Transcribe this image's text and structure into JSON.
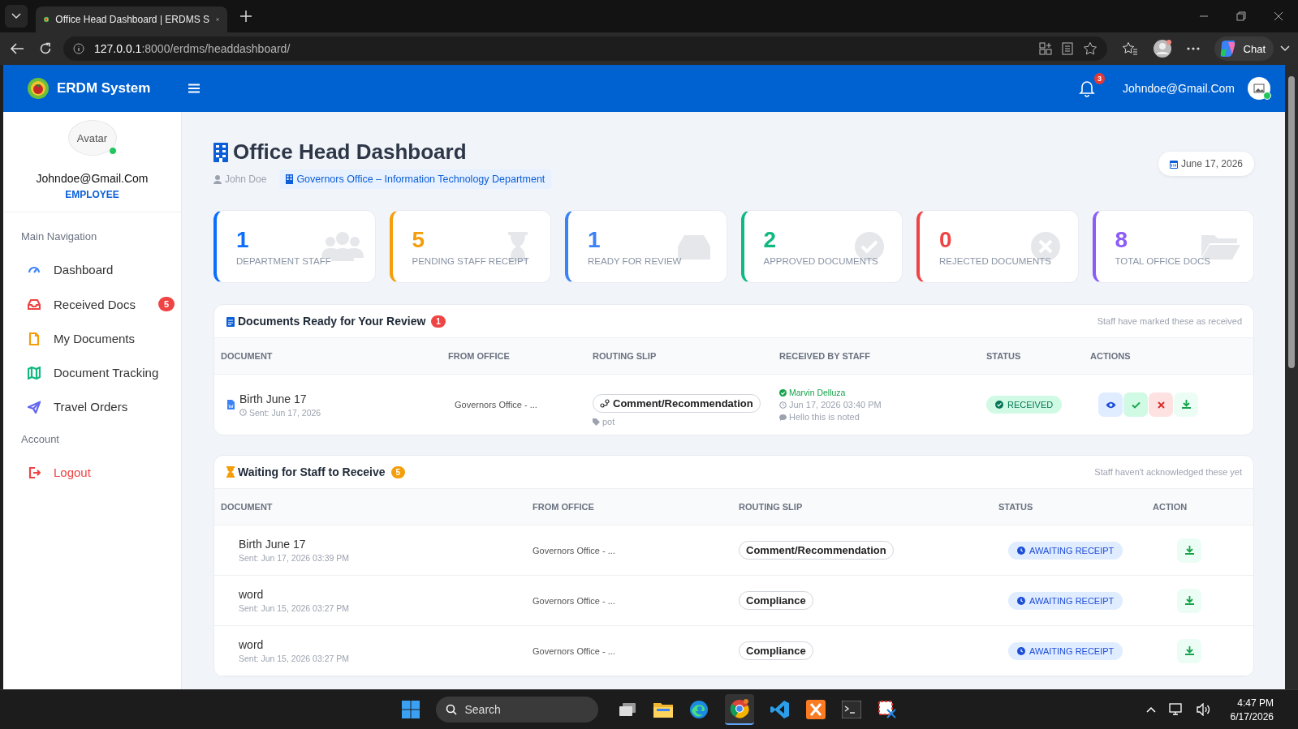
{
  "browser": {
    "tab_title": "Office Head Dashboard | ERDMS S",
    "url_host": "127.0.0.1",
    "url_path": ":8000/erdms/headdashboard/",
    "chat_label": "Chat"
  },
  "header": {
    "brand": "ERDM System",
    "notification_count": "3",
    "user_email": "Johndoe@Gmail.Com"
  },
  "sidebar": {
    "avatar_alt": "Avatar",
    "email": "Johndoe@Gmail.Com",
    "role": "EMPLOYEE",
    "sections": [
      {
        "title": "Main Navigation",
        "items": [
          {
            "label": "Dashboard",
            "color": "#3b82f6"
          },
          {
            "label": "Received Docs",
            "color": "#ef4444",
            "badge": "5"
          },
          {
            "label": "My Documents",
            "color": "#f59e0b"
          },
          {
            "label": "Document Tracking",
            "color": "#10b981"
          },
          {
            "label": "Travel Orders",
            "color": "#6366f1"
          }
        ]
      },
      {
        "title": "Account",
        "items": [
          {
            "label": "Logout",
            "color": "#ef4444",
            "kind": "danger"
          }
        ]
      }
    ]
  },
  "page": {
    "title": "Office Head Dashboard",
    "user": "John Doe",
    "office": "Governors Office – Information Technology Department",
    "date": "June 17, 2026"
  },
  "stats": [
    {
      "value": "1",
      "label": "DEPARTMENT STAFF",
      "color": "#0d6efd"
    },
    {
      "value": "5",
      "label": "PENDING STAFF RECEIPT",
      "color": "#f59e0b"
    },
    {
      "value": "1",
      "label": "READY FOR REVIEW",
      "color": "#3b82f6"
    },
    {
      "value": "2",
      "label": "APPROVED DOCUMENTS",
      "color": "#10b981"
    },
    {
      "value": "0",
      "label": "REJECTED DOCUMENTS",
      "color": "#ef4444"
    },
    {
      "value": "8",
      "label": "TOTAL OFFICE DOCS",
      "color": "#8b5cf6"
    }
  ],
  "review": {
    "title": "Documents Ready for Your Review",
    "count": "1",
    "note": "Staff have marked these as received",
    "columns": [
      "DOCUMENT",
      "FROM OFFICE",
      "ROUTING SLIP",
      "RECEIVED BY STAFF",
      "STATUS",
      "ACTIONS"
    ],
    "rows": [
      {
        "document": "Birth June 17",
        "sent": "Sent: Jun 17, 2026",
        "from_office": "Governors Office - ...",
        "routing_slip": "Comment/Recommendation",
        "tag": "pot",
        "staff": "Marvin Delluza",
        "received_at": "Jun 17, 2026 03:40 PM",
        "remark": "Hello this is noted",
        "status": "RECEIVED",
        "kind": "received"
      }
    ]
  },
  "waiting": {
    "title": "Waiting for Staff to Receive",
    "count": "5",
    "note": "Staff haven't acknowledged these yet",
    "columns": [
      "DOCUMENT",
      "FROM OFFICE",
      "ROUTING SLIP",
      "STATUS",
      "ACTION"
    ],
    "rows": [
      {
        "document": "Birth June 17",
        "sent": "Sent: Jun 17, 2026 03:39 PM",
        "from_office": "Governors Office - ...",
        "routing_slip": "Comment/Recommendation",
        "status": "AWAITING RECEIPT",
        "kind": "awaiting"
      },
      {
        "document": "word",
        "sent": "Sent: Jun 15, 2026 03:27 PM",
        "from_office": "Governors Office - ...",
        "routing_slip": "Compliance",
        "status": "AWAITING RECEIPT",
        "kind": "awaiting"
      },
      {
        "document": "word",
        "sent": "Sent: Jun 15, 2026 03:27 PM",
        "from_office": "Governors Office - ...",
        "routing_slip": "Compliance",
        "status": "AWAITING RECEIPT",
        "kind": "awaiting"
      }
    ]
  },
  "taskbar": {
    "search_placeholder": "Search",
    "time": "4:47 PM",
    "date": "6/17/2026"
  }
}
